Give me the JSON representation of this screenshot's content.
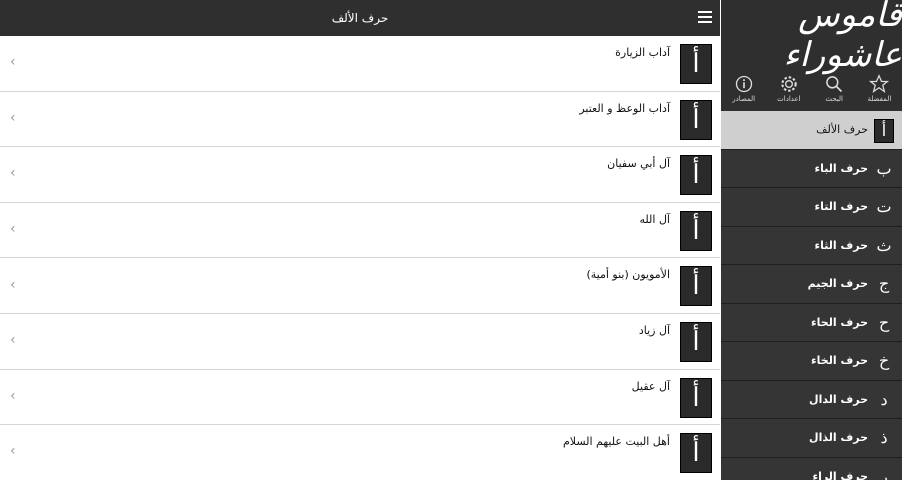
{
  "header": {
    "title": "حرف الألف",
    "menu_icon": "hamburger-menu-icon"
  },
  "list": [
    {
      "letter": "أ",
      "label": "آداب الزيارة"
    },
    {
      "letter": "أ",
      "label": "آداب الوعظ و العتبر"
    },
    {
      "letter": "أ",
      "label": "آل أبي سفيان"
    },
    {
      "letter": "أ",
      "label": "آل الله"
    },
    {
      "letter": "أ",
      "label": "الأمويون (بنو أمية)"
    },
    {
      "letter": "أ",
      "label": "آل زياد"
    },
    {
      "letter": "أ",
      "label": "آل عقيل"
    },
    {
      "letter": "أ",
      "label": "أهل البيت عليهم السلام"
    }
  ],
  "sidebar": {
    "logo_text": "قاموس عاشوراء",
    "icons": [
      {
        "name": "star-icon",
        "label": "المفضلة"
      },
      {
        "name": "search-icon",
        "label": "البحث"
      },
      {
        "name": "gear-icon",
        "label": "اعدادات"
      },
      {
        "name": "info-icon",
        "label": "المصادر"
      }
    ],
    "nav": [
      {
        "letter": "أ",
        "label": "حرف الألف",
        "active": true
      },
      {
        "letter": "ب",
        "label": "حرف الباء"
      },
      {
        "letter": "ت",
        "label": "حرف التاء"
      },
      {
        "letter": "ث",
        "label": "حرف الثاء"
      },
      {
        "letter": "ج",
        "label": "حرف الجيم"
      },
      {
        "letter": "ح",
        "label": "حرف الحاء"
      },
      {
        "letter": "خ",
        "label": "حرف الخاء"
      },
      {
        "letter": "د",
        "label": "حرف الدال"
      },
      {
        "letter": "ذ",
        "label": "حرف الذال"
      },
      {
        "letter": "ر",
        "label": "حرف الراء"
      }
    ]
  },
  "chevron_glyph": "‹",
  "colors": {
    "bar": "#2f2f2f",
    "active_nav": "#cfcfcf",
    "tile": "#2a2a2a"
  }
}
